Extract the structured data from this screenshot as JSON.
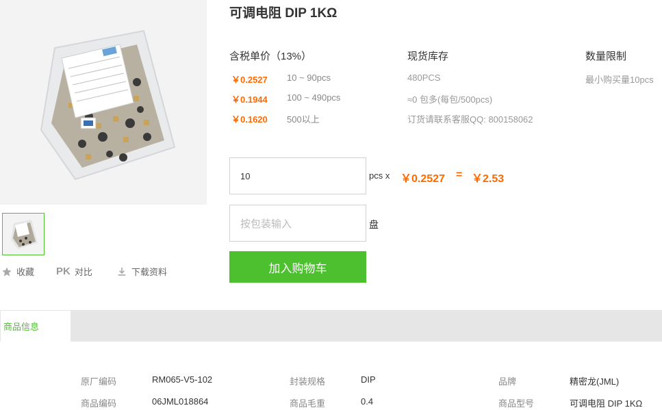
{
  "product": {
    "title": "可调电阻 DIP 1KΩ"
  },
  "actions": {
    "favorite": "收藏",
    "compare_prefix": "PK",
    "compare": "对比",
    "download": "下载资料"
  },
  "pricing": {
    "headers": {
      "price": "含税单价（13%）",
      "stock": "现货库存",
      "limit": "数量限制"
    },
    "tiers": [
      {
        "price": "￥0.2527",
        "range": "10 ~ 90pcs"
      },
      {
        "price": "￥0.1944",
        "range": "100 ~ 490pcs"
      },
      {
        "price": "￥0.1620",
        "range": "500以上"
      }
    ],
    "stock_lines": [
      "480PCS",
      "≈0 包多(每包/500pcs)",
      "订货请联系客服QQ: 800158062"
    ],
    "limit_text": "最小购买量10pcs"
  },
  "order": {
    "quantity_value": "10",
    "unit_pcs": "pcs x",
    "unit_price": "￥0.2527",
    "equals": "=",
    "total": "￥2.53",
    "package_placeholder": "按包装输入",
    "unit_pan": "盘",
    "add_to_cart": "加入购物车"
  },
  "tabs": {
    "product_info": "商品信息"
  },
  "specs": [
    {
      "label": "原厂编码",
      "value": "RM065-V5-102"
    },
    {
      "label": "封装规格",
      "value": "DIP"
    },
    {
      "label": "品牌",
      "value": "精密龙(JML)"
    },
    {
      "label": "商品编码",
      "value": "06JML018864"
    },
    {
      "label": "商品毛重",
      "value": "0.4"
    },
    {
      "label": "商品型号",
      "value": "可调电阻 DIP 1KΩ"
    }
  ],
  "colors": {
    "accent_green": "#4cc02e",
    "price_orange": "#ff6a00"
  }
}
